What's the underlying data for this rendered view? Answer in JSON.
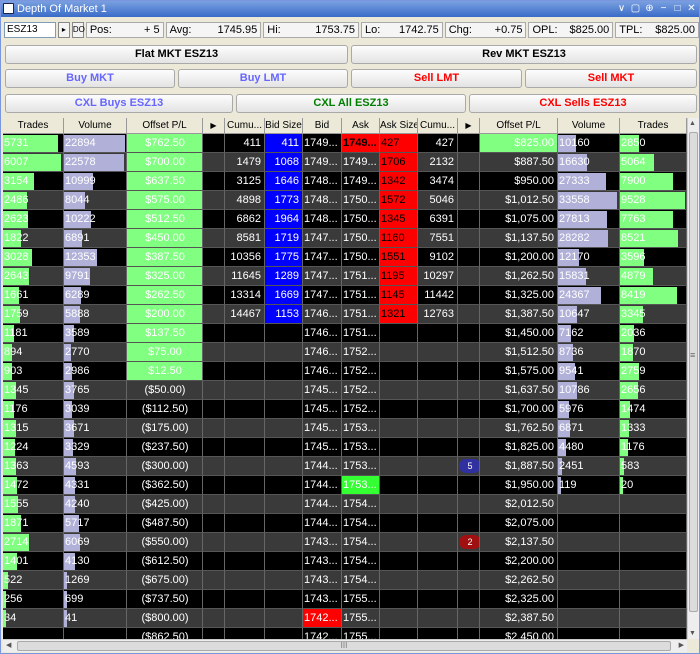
{
  "window": {
    "title": "Depth Of Market 1",
    "controls": [
      "∨",
      "▢",
      "⊕",
      "−",
      "□",
      "✕"
    ]
  },
  "info": {
    "symbol": "ESZ13",
    "pos_label": "Pos:",
    "pos": "+ 5",
    "avg_label": "Avg:",
    "avg": "1745.95",
    "hi_label": "Hi:",
    "hi": "1753.75",
    "lo_label": "Lo:",
    "lo": "1742.75",
    "chg_label": "Chg:",
    "chg": "+0.75",
    "opl_label": "OPL:",
    "opl": "$825.00",
    "tpl_label": "TPL:",
    "tpl": "$825.00"
  },
  "buttons": {
    "flat_mkt": "Flat MKT ESZ13",
    "rev_mkt": "Rev MKT ESZ13",
    "buy_mkt": "Buy MKT",
    "buy_lmt": "Buy LMT",
    "sell_lmt": "Sell LMT",
    "sell_mkt": "Sell MKT",
    "cxl_buys": "CXL Buys ESZ13",
    "cxl_all": "CXL All ESZ13",
    "cxl_sells": "CXL Sells ESZ13"
  },
  "colors": {
    "buy_text": "#6666ff",
    "sell_text": "#ff0000",
    "cxl_all_text": "#008000",
    "bid_blue": "#0000ff",
    "ask_red": "#ff0000",
    "green_pl": "#80ff80",
    "lavender": "#b0b0d8",
    "badge_blue": "#3030a0",
    "badge_red": "#a01010"
  },
  "headers": [
    "Trades",
    "Volume",
    "Offset P/L",
    "▶",
    "Cumu...",
    "Bid Size",
    "Bid",
    "Ask",
    "Ask Size",
    "Cumu...",
    "▶",
    "Offset P/L",
    "Volume",
    "Trades"
  ],
  "rows": [
    {
      "lt": "5731",
      "lv": "22894",
      "lp": "$762.50",
      "bc": "411",
      "bs": "411",
      "bid": "1749...",
      "ask": "1749...",
      "as": "427",
      "ac": "427",
      "rp": "$825.00",
      "rv": "10160",
      "rt": "2850"
    },
    {
      "lt": "6007",
      "lv": "22578",
      "lp": "$700.00",
      "bc": "1479",
      "bs": "1068",
      "bid": "1749...",
      "ask": "1749...",
      "as": "1706",
      "ac": "2132",
      "rp": "$887.50",
      "rv": "16630",
      "rt": "5064"
    },
    {
      "lt": "3154",
      "lv": "10999",
      "lp": "$637.50",
      "bc": "3125",
      "bs": "1646",
      "bid": "1748...",
      "ask": "1749...",
      "as": "1342",
      "ac": "3474",
      "rp": "$950.00",
      "rv": "27333",
      "rt": "7900"
    },
    {
      "lt": "2486",
      "lv": "8044",
      "lp": "$575.00",
      "bc": "4898",
      "bs": "1773",
      "bid": "1748...",
      "ask": "1750...",
      "as": "1572",
      "ac": "5046",
      "rp": "$1,012.50",
      "rv": "33558",
      "rt": "9528"
    },
    {
      "lt": "2623",
      "lv": "10222",
      "lp": "$512.50",
      "bc": "6862",
      "bs": "1964",
      "bid": "1748...",
      "ask": "1750...",
      "as": "1345",
      "ac": "6391",
      "rp": "$1,075.00",
      "rv": "27813",
      "rt": "7763"
    },
    {
      "lt": "1822",
      "lv": "6891",
      "lp": "$450.00",
      "bc": "8581",
      "bs": "1719",
      "bid": "1747...",
      "ask": "1750...",
      "as": "1160",
      "ac": "7551",
      "rp": "$1,137.50",
      "rv": "28282",
      "rt": "8521"
    },
    {
      "lt": "3028",
      "lv": "12353",
      "lp": "$387.50",
      "bc": "10356",
      "bs": "1775",
      "bid": "1747...",
      "ask": "1750...",
      "as": "1551",
      "ac": "9102",
      "rp": "$1,200.00",
      "rv": "12170",
      "rt": "3596"
    },
    {
      "lt": "2643",
      "lv": "9791",
      "lp": "$325.00",
      "bc": "11645",
      "bs": "1289",
      "bid": "1747...",
      "ask": "1751...",
      "as": "1195",
      "ac": "10297",
      "rp": "$1,262.50",
      "rv": "15831",
      "rt": "4879"
    },
    {
      "lt": "1661",
      "lv": "6289",
      "lp": "$262.50",
      "bc": "13314",
      "bs": "1669",
      "bid": "1747...",
      "ask": "1751...",
      "as": "1145",
      "ac": "11442",
      "rp": "$1,325.00",
      "rv": "24367",
      "rt": "8419"
    },
    {
      "lt": "1759",
      "lv": "5888",
      "lp": "$200.00",
      "bc": "14467",
      "bs": "1153",
      "bid": "1746...",
      "ask": "1751...",
      "as": "1321",
      "ac": "12763",
      "rp": "$1,387.50",
      "rv": "10647",
      "rt": "3345"
    },
    {
      "lt": "1181",
      "lv": "3589",
      "lp": "$137.50",
      "bc": "",
      "bs": "",
      "bid": "1746...",
      "ask": "1751...",
      "as": "",
      "ac": "",
      "rp": "$1,450.00",
      "rv": "7162",
      "rt": "2036"
    },
    {
      "lt": "894",
      "lv": "2770",
      "lp": "$75.00",
      "bc": "",
      "bs": "",
      "bid": "1746...",
      "ask": "1752...",
      "as": "",
      "ac": "",
      "rp": "$1,512.50",
      "rv": "8736",
      "rt": "1870"
    },
    {
      "lt": "903",
      "lv": "2986",
      "lp": "$12.50",
      "bc": "",
      "bs": "",
      "bid": "1746...",
      "ask": "1752...",
      "as": "",
      "ac": "",
      "rp": "$1,575.00",
      "rv": "9541",
      "rt": "2759"
    },
    {
      "lt": "1345",
      "lv": "3765",
      "lp": "($50.00)",
      "bc": "",
      "bs": "",
      "bid": "1745...",
      "ask": "1752...",
      "as": "",
      "ac": "",
      "rp": "$1,637.50",
      "rv": "10786",
      "rt": "2656"
    },
    {
      "lt": "1176",
      "lv": "3039",
      "lp": "($112.50)",
      "bc": "",
      "bs": "",
      "bid": "1745...",
      "ask": "1752...",
      "as": "",
      "ac": "",
      "rp": "$1,700.00",
      "rv": "5976",
      "rt": "1474"
    },
    {
      "lt": "1315",
      "lv": "3671",
      "lp": "($175.00)",
      "bc": "",
      "bs": "",
      "bid": "1745...",
      "ask": "1753...",
      "as": "",
      "ac": "",
      "rp": "$1,762.50",
      "rv": "6871",
      "rt": "1333"
    },
    {
      "lt": "1224",
      "lv": "3329",
      "lp": "($237.50)",
      "bc": "",
      "bs": "",
      "bid": "1745...",
      "ask": "1753...",
      "as": "",
      "ac": "",
      "rp": "$1,825.00",
      "rv": "4480",
      "rt": "1176"
    },
    {
      "lt": "1363",
      "lv": "4593",
      "lp": "($300.00)",
      "bc": "",
      "bs": "",
      "bid": "1744...",
      "ask": "1753...",
      "as": "",
      "ac": "",
      "rp": "$1,887.50",
      "rv": "2451",
      "rt": "583",
      "badge": "5"
    },
    {
      "lt": "1472",
      "lv": "4331",
      "lp": "($362.50)",
      "bc": "",
      "bs": "",
      "bid": "1744...",
      "ask": "1753...",
      "as": "",
      "ac": "",
      "rp": "$1,950.00",
      "rv": "119",
      "rt": "20"
    },
    {
      "lt": "1555",
      "lv": "4240",
      "lp": "($425.00)",
      "bc": "",
      "bs": "",
      "bid": "1744...",
      "ask": "1754...",
      "as": "",
      "ac": "",
      "rp": "$2,012.50",
      "rv": "",
      "rt": ""
    },
    {
      "lt": "1871",
      "lv": "5717",
      "lp": "($487.50)",
      "bc": "",
      "bs": "",
      "bid": "1744...",
      "ask": "1754...",
      "as": "",
      "ac": "",
      "rp": "$2,075.00",
      "rv": "",
      "rt": ""
    },
    {
      "lt": "2714",
      "lv": "6069",
      "lp": "($550.00)",
      "bc": "",
      "bs": "",
      "bid": "1743...",
      "ask": "1754...",
      "as": "",
      "ac": "",
      "rp": "$2,137.50",
      "rv": "",
      "rt": "",
      "badge": "2"
    },
    {
      "lt": "1401",
      "lv": "4130",
      "lp": "($612.50)",
      "bc": "",
      "bs": "",
      "bid": "1743...",
      "ask": "1754...",
      "as": "",
      "ac": "",
      "rp": "$2,200.00",
      "rv": "",
      "rt": ""
    },
    {
      "lt": "522",
      "lv": "1269",
      "lp": "($675.00)",
      "bc": "",
      "bs": "",
      "bid": "1743...",
      "ask": "1754...",
      "as": "",
      "ac": "",
      "rp": "$2,262.50",
      "rv": "",
      "rt": ""
    },
    {
      "lt": "256",
      "lv": "699",
      "lp": "($737.50)",
      "bc": "",
      "bs": "",
      "bid": "1743...",
      "ask": "1755...",
      "as": "",
      "ac": "",
      "rp": "$2,325.00",
      "rv": "",
      "rt": ""
    },
    {
      "lt": "34",
      "lv": "41",
      "lp": "($800.00)",
      "bc": "",
      "bs": "",
      "bid": "1742...",
      "ask": "1755...",
      "as": "",
      "ac": "",
      "rp": "$2,387.50",
      "rv": "",
      "rt": ""
    },
    {
      "lt": "",
      "lv": "",
      "lp": "($862.50)",
      "bc": "",
      "bs": "",
      "bid": "1742...",
      "ask": "1755...",
      "as": "",
      "ac": "",
      "rp": "$2,450.00",
      "rv": "",
      "rt": ""
    }
  ],
  "special_cells": {
    "last_bid_row": 25,
    "ask_bold_row": 0,
    "ask_green_row": 18
  },
  "scroll": {
    "hscroll_label": "III",
    "vscroll_grip": "≡",
    "up": "▲",
    "down": "▼",
    "left": "◀",
    "right": "▶"
  }
}
